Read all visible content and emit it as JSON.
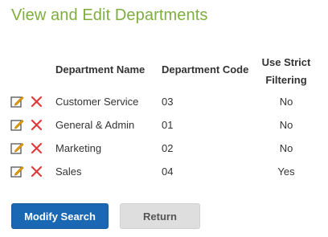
{
  "page": {
    "title": "View and Edit Departments"
  },
  "table": {
    "headers": {
      "name": "Department Name",
      "code": "Department Code",
      "strict": "Use Strict Filtering"
    },
    "rows": [
      {
        "name": "Customer Service",
        "code": "03",
        "strict": "No"
      },
      {
        "name": "General & Admin",
        "code": "01",
        "strict": "No"
      },
      {
        "name": "Marketing",
        "code": "02",
        "strict": "No"
      },
      {
        "name": "Sales",
        "code": "04",
        "strict": "Yes"
      }
    ]
  },
  "actions": {
    "modify_label": "Modify Search",
    "return_label": "Return"
  },
  "icons": {
    "edit": "edit-pencil-icon",
    "delete": "delete-x-icon"
  },
  "colors": {
    "title": "#7fae3e",
    "primary_button": "#1a67b3",
    "secondary_button": "#dedede",
    "delete_icon": "#e23b3b",
    "edit_icon": "#f0a500"
  }
}
